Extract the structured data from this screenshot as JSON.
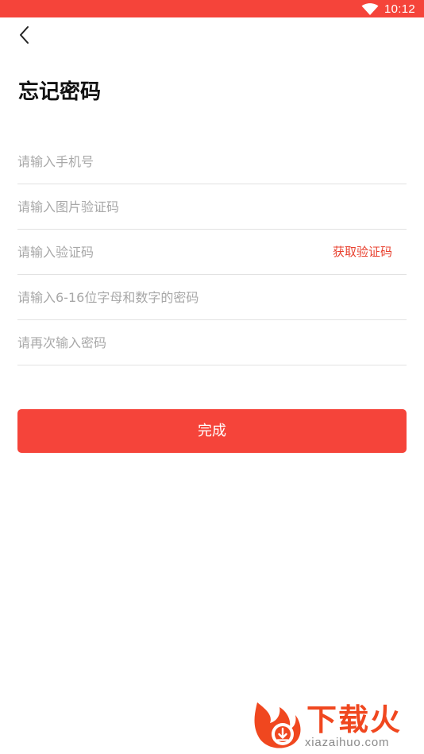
{
  "status_bar": {
    "time": "10:12",
    "wifi_icon": "wifi-icon",
    "background_color": "#f5443a"
  },
  "header": {
    "back_icon": "chevron-left-icon",
    "title": "忘记密码"
  },
  "form": {
    "phone": {
      "placeholder": "请输入手机号",
      "value": ""
    },
    "image_captcha": {
      "placeholder": "请输入图片验证码",
      "value": ""
    },
    "sms_code": {
      "placeholder": "请输入验证码",
      "value": ""
    },
    "get_code_label": "获取验证码",
    "password": {
      "placeholder": "请输入6-16位字母和数字的密码",
      "value": ""
    },
    "confirm_password": {
      "placeholder": "请再次输入密码",
      "value": ""
    }
  },
  "submit": {
    "label": "完成"
  },
  "watermark": {
    "brand": "下载火",
    "url": "xiazaihuo.com"
  },
  "colors": {
    "accent": "#f5443a",
    "link": "#e8412f",
    "placeholder": "#a8a8a8",
    "divider": "#e2e2e2"
  }
}
